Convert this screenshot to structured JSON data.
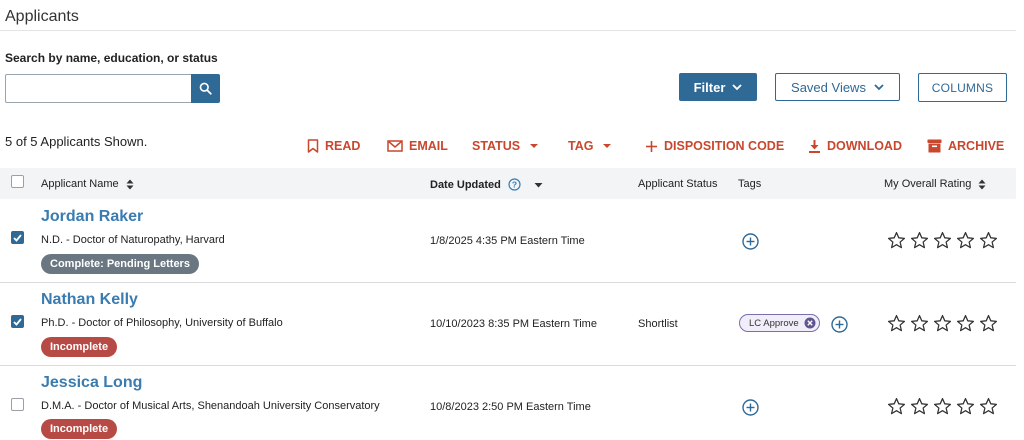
{
  "page": {
    "title": "Applicants"
  },
  "search": {
    "label": "Search by name, education, or status",
    "value": "",
    "placeholder": ""
  },
  "toolbar": {
    "filter_label": "Filter",
    "saved_views_label": "Saved Views",
    "columns_label": "COLUMNS",
    "count_text": "5 of 5 Applicants Shown."
  },
  "actions": {
    "read": "READ",
    "email": "EMAIL",
    "status": "STATUS",
    "tag": "TAG",
    "disposition": "DISPOSITION CODE",
    "download": "DOWNLOAD",
    "archive": "ARCHIVE"
  },
  "table": {
    "headers": {
      "name": "Applicant Name",
      "date_updated": "Date Updated",
      "status": "Applicant Status",
      "tags": "Tags",
      "rating": "My Overall Rating"
    },
    "rows": [
      {
        "checked": true,
        "name": "Jordan Raker",
        "education": "N.D. - Doctor of Naturopathy, Harvard",
        "badge": "Complete: Pending Letters",
        "badge_color": "#6a7782",
        "date": "1/8/2025 4:35 PM Eastern Time",
        "status": "",
        "tags": [],
        "rating": 0
      },
      {
        "checked": true,
        "name": "Nathan Kelly",
        "education": "Ph.D. - Doctor of Philosophy, University of Buffalo",
        "badge": "Incomplete",
        "badge_color": "#b84a45",
        "date": "10/10/2023 8:35 PM Eastern Time",
        "status": "Shortlist",
        "tags": [
          "LC Approve"
        ],
        "rating": 0
      },
      {
        "checked": false,
        "name": "Jessica Long",
        "education": "D.M.A. - Doctor of Musical Arts, Shenandoah University Conservatory",
        "badge": "Incomplete",
        "badge_color": "#b84a45",
        "date": "10/8/2023 2:50 PM Eastern Time",
        "status": "",
        "tags": [],
        "rating": 0
      }
    ]
  },
  "colors": {
    "primary": "#2f6996",
    "action": "#c8472d",
    "link": "#3a7bb0"
  }
}
